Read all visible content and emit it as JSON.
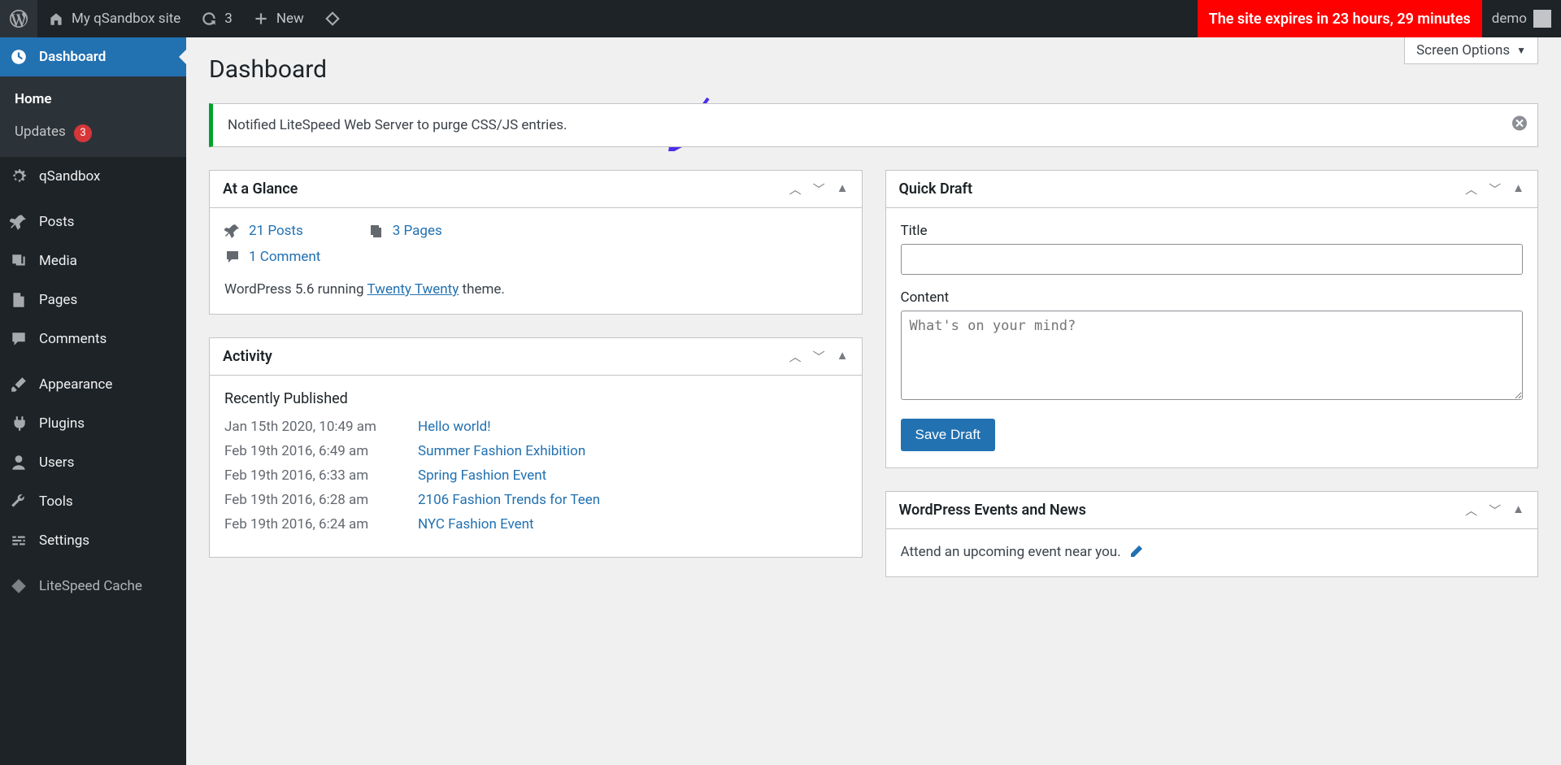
{
  "adminbar": {
    "site_name": "My qSandbox site",
    "updates_count": "3",
    "new_label": "New",
    "expire_text": "The site expires in  23 hours, 29 minutes",
    "user_name": "demo"
  },
  "sidemenu": {
    "dashboard": "Dashboard",
    "home": "Home",
    "updates": "Updates",
    "updates_count": "3",
    "qsandbox": "qSandbox",
    "posts": "Posts",
    "media": "Media",
    "pages": "Pages",
    "comments": "Comments",
    "appearance": "Appearance",
    "plugins": "Plugins",
    "users": "Users",
    "tools": "Tools",
    "settings": "Settings",
    "litespeed": "LiteSpeed Cache"
  },
  "screen_options": "Screen Options",
  "page_title": "Dashboard",
  "notice": "Notified LiteSpeed Web Server to purge CSS/JS entries.",
  "widgets": {
    "glance": {
      "title": "At a Glance",
      "posts": "21 Posts",
      "pages": "3 Pages",
      "comments": "1 Comment",
      "wp_line_a": "WordPress 5.6 running ",
      "theme": "Twenty Twenty",
      "wp_line_b": " theme."
    },
    "activity": {
      "title": "Activity",
      "sub": "Recently Published",
      "rows": [
        {
          "date": "Jan 15th 2020, 10:49 am",
          "title": "Hello world!"
        },
        {
          "date": "Feb 19th 2016, 6:49 am",
          "title": "Summer Fashion Exhibition"
        },
        {
          "date": "Feb 19th 2016, 6:33 am",
          "title": "Spring Fashion Event"
        },
        {
          "date": "Feb 19th 2016, 6:28 am",
          "title": "2106 Fashion Trends for Teen"
        },
        {
          "date": "Feb 19th 2016, 6:24 am",
          "title": "NYC Fashion Event"
        }
      ]
    },
    "quickdraft": {
      "title": "Quick Draft",
      "title_label": "Title",
      "content_label": "Content",
      "content_placeholder": "What's on your mind?",
      "save": "Save Draft"
    },
    "events": {
      "title": "WordPress Events and News",
      "attend": "Attend an upcoming event near you."
    }
  }
}
